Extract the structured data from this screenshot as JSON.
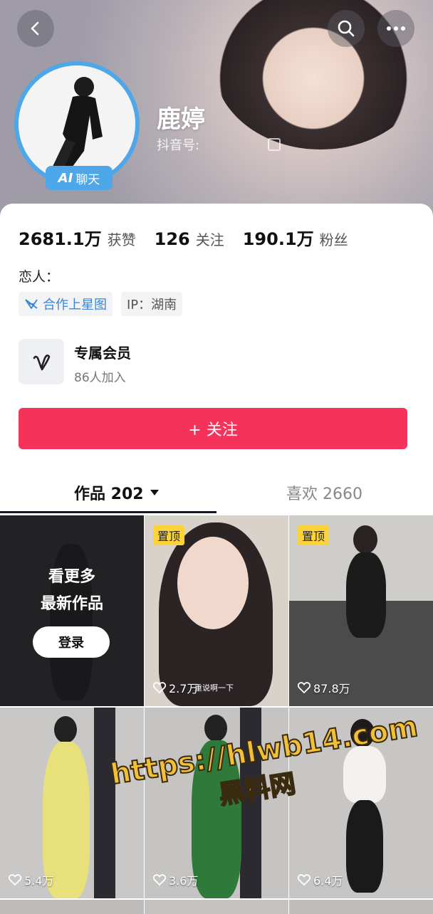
{
  "profile": {
    "name": "鹿婷",
    "handle_label": "抖音号:",
    "ai_badge_prefix": "AI",
    "ai_badge_label": "聊天"
  },
  "stats": {
    "likes_value": "2681.1万",
    "likes_label": "获赞",
    "following_value": "126",
    "following_label": "关注",
    "followers_value": "190.1万",
    "followers_label": "粉丝"
  },
  "bio": "恋人：",
  "tags": {
    "star_map": "合作上星图",
    "ip": "IP：湖南"
  },
  "membership": {
    "title": "专属会员",
    "subtitle": "86人加入"
  },
  "follow_button": "+ 关注",
  "tabs": {
    "works": "作品 202",
    "liked": "喜欢 2660"
  },
  "grid": {
    "login_prompt_line1": "看更多",
    "login_prompt_line2": "最新作品",
    "login_button": "登录",
    "pinned_label": "置顶",
    "items": [
      {
        "likes": "2.7万",
        "caption": "重说啊一下"
      },
      {
        "likes": "87.8万"
      },
      {
        "likes": "5.4万"
      },
      {
        "likes": "3.6万"
      },
      {
        "likes": "6.4万"
      }
    ]
  },
  "watermark": {
    "url": "https://hlwb14.com",
    "name": "黑料网"
  },
  "colors": {
    "accent": "#f5325a",
    "ai_blue": "#4da7e8",
    "pin_yellow": "#fcd33a"
  }
}
